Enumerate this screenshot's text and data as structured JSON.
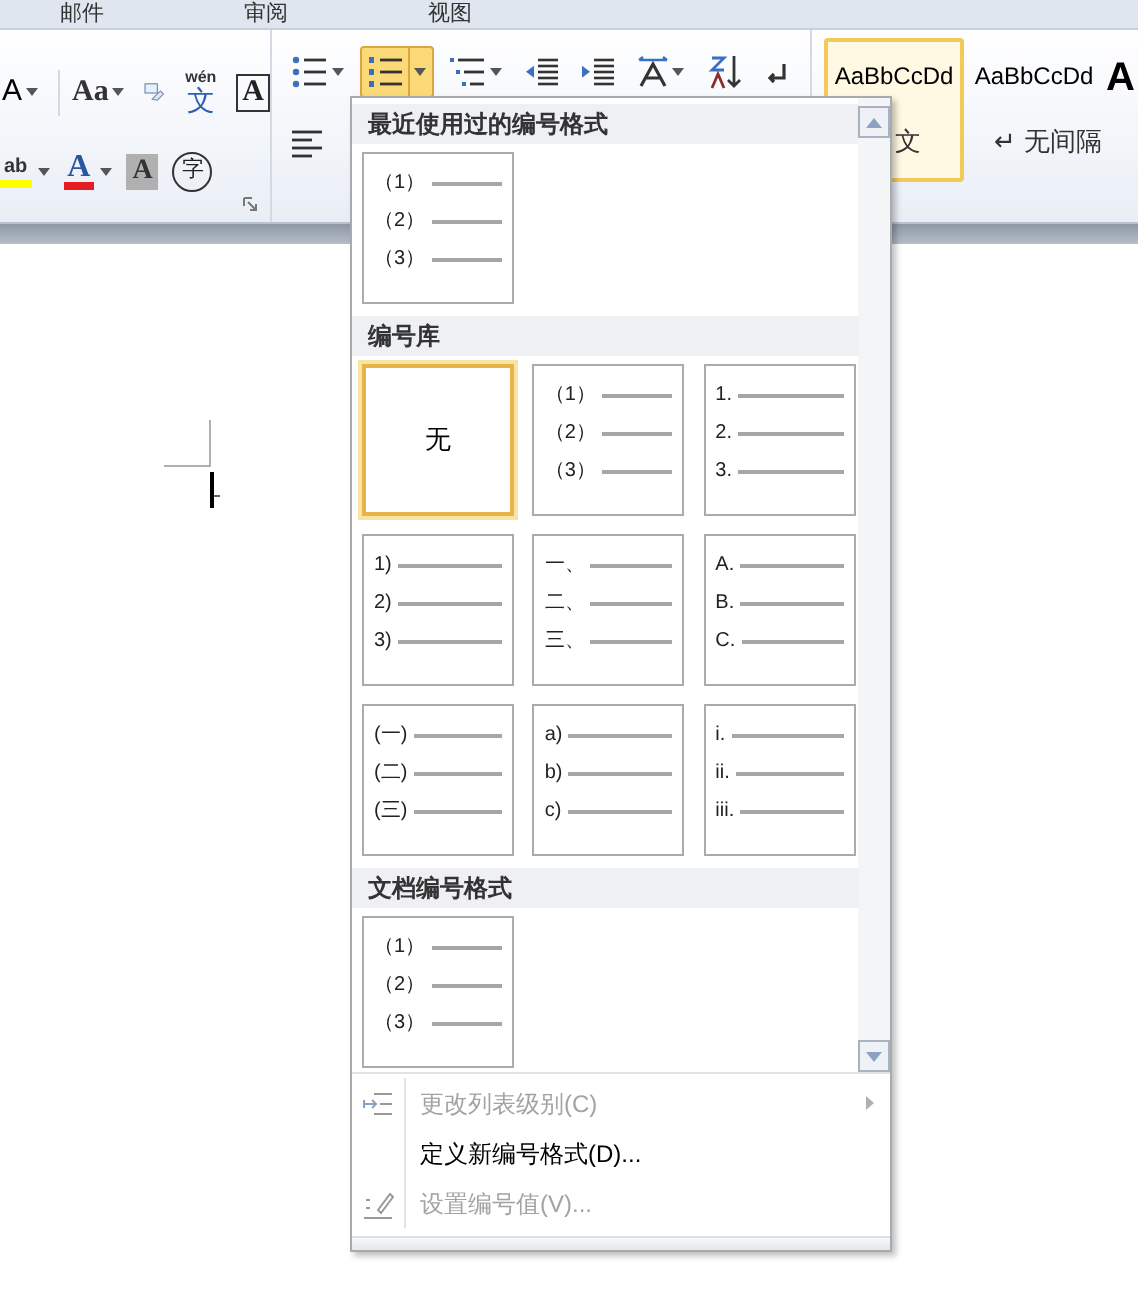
{
  "ribbon_tabs": [
    "邮件",
    "审阅",
    "视图"
  ],
  "font_group": {
    "grow_char": "A",
    "change_case": "Aa",
    "phonetic_pinyin": "wén",
    "phonetic_char": "文",
    "border_char": "A",
    "highlight_char": "ab",
    "font_color_char": "A",
    "shading_char": "A",
    "enclose_char": "字"
  },
  "paragraph_buttons": [
    {
      "kind": "bullets",
      "selected": false
    },
    {
      "kind": "numbering",
      "selected": true
    },
    {
      "kind": "multilevel",
      "selected": false
    },
    {
      "kind": "outdent",
      "selected": false
    },
    {
      "kind": "indent",
      "selected": false
    },
    {
      "kind": "direction",
      "selected": false
    },
    {
      "kind": "sort",
      "selected": false
    },
    {
      "kind": "marks",
      "selected": false
    }
  ],
  "styles": [
    {
      "sample": "AaBbCcDd",
      "name": "文",
      "selected": true
    },
    {
      "sample": "AaBbCcDd",
      "name": "↵ 无间隔",
      "selected": false
    }
  ],
  "style_big_sample": "A",
  "numbering_menu": {
    "sections": [
      {
        "title": "最近使用过的编号格式",
        "items": [
          {
            "kind": "list",
            "lines": [
              "（1）",
              "（2）",
              "（3）"
            ],
            "selected": false
          }
        ]
      },
      {
        "title": "编号库",
        "items": [
          {
            "kind": "none",
            "label": "无",
            "selected": true
          },
          {
            "kind": "list",
            "lines": [
              "（1）",
              "（2）",
              "（3）"
            ],
            "selected": false
          },
          {
            "kind": "list",
            "lines": [
              "1.",
              "2.",
              "3."
            ],
            "selected": false
          },
          {
            "kind": "list",
            "lines": [
              "1)",
              "2)",
              "3)"
            ],
            "selected": false
          },
          {
            "kind": "list",
            "lines": [
              "一、",
              "二、",
              "三、"
            ],
            "selected": false
          },
          {
            "kind": "list",
            "lines": [
              "A.",
              "B.",
              "C."
            ],
            "selected": false
          },
          {
            "kind": "list",
            "lines": [
              "(一)",
              "(二)",
              "(三)"
            ],
            "selected": false
          },
          {
            "kind": "list",
            "lines": [
              "a)",
              "b)",
              "c)"
            ],
            "selected": false
          },
          {
            "kind": "list",
            "lines": [
              "i.",
              "ii.",
              "iii."
            ],
            "selected": false
          }
        ]
      },
      {
        "title": "文档编号格式",
        "items": [
          {
            "kind": "list",
            "lines": [
              "（1）",
              "（2）",
              "（3）"
            ],
            "selected": false
          }
        ]
      }
    ],
    "commands": [
      {
        "kind": "level",
        "label": "更改列表级别(C)",
        "disabled": true,
        "has_submenu": true
      },
      {
        "kind": "define",
        "label": "定义新编号格式(D)...",
        "disabled": false,
        "has_submenu": false
      },
      {
        "kind": "value",
        "label": "设置编号值(V)...",
        "disabled": true,
        "has_submenu": false
      }
    ]
  }
}
